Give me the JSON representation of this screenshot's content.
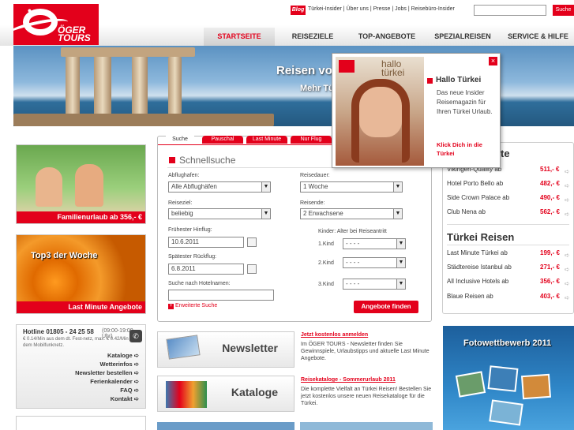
{
  "header": {
    "blog_badge": "Blog",
    "links": "Türkei-Insider | Über uns | Presse | Jobs | Reisebüro-Insider",
    "search_button": "Suche",
    "logo_top": "ÖGER",
    "logo_bottom": "TOURS"
  },
  "nav": [
    "STARTSEITE",
    "REISEZIELE",
    "TOP-ANGEBOTE",
    "SPEZIALREISEN",
    "SERVICE & HILFE"
  ],
  "hero": {
    "line1": "Reisen vo",
    "line2": "Mehr Tü"
  },
  "tiles": {
    "family": "Familienurlaub ab 356,- €",
    "top3": "Top3 der Woche",
    "lastminute": "Last Minute Angebote"
  },
  "hotline": {
    "title": "Hotline 01805 - 24 25 58",
    "hours": "(09:00-19:00 Uhr)",
    "note": "€ 0.14/Min aus dem dt. Fest-netz, max. € 0.42/Min aus dem Mobilfunknetz.",
    "links": [
      "Kataloge",
      "Wetterinfos",
      "Newsletter bestellen",
      "Ferienkalender",
      "FAQ",
      "Kontakt"
    ]
  },
  "search": {
    "tabs": [
      "Suche",
      "Pauschal",
      "Last Minute",
      "Nur Flug"
    ],
    "title": "Schnellsuche",
    "airport_label": "Abflughafen:",
    "airport_value": "Alle Abflughäfen",
    "duration_label": "Reisedauer:",
    "duration_value": "1 Woche",
    "destination_label": "Reiseziel:",
    "destination_value": "beliebig",
    "travellers_label": "Reisende:",
    "travellers_value": "2 Erwachsene",
    "earliest_label": "Frühester Hinflug:",
    "earliest_value": "10.6.2011",
    "latest_label": "Spätester Rückflug:",
    "latest_value": "6.8.2011",
    "children_label": "Kinder: Alter bei Reiseantritt",
    "kids": [
      "1.Kind",
      "2.Kind",
      "3.Kind"
    ],
    "kid_value": "- - - -",
    "hotel_label": "Suche nach Hotelnamen:",
    "extended": "Erweiterte Suche",
    "submit": "Angebote finden"
  },
  "promos": {
    "newsletter": "Newsletter",
    "kataloge": "Kataloge"
  },
  "news": [
    {
      "title": "Jetzt kostenlos anmelden",
      "body": "Im ÖGER TOURS - Newsletter finden Sie Gewinnspiele, Urlaubstipps und aktuelle Last Minute Angebote."
    },
    {
      "title": "Reisekataloge - Sommerurlaub 2011",
      "body": "Die komplette Vielfalt an Türkei Reisen! Bestellen Sie jetzt kostenlos unsere neuen Reisekataloge für die Türkei."
    }
  ],
  "right": {
    "head_partial": "te",
    "hotels": [
      {
        "name": "Vikingen-Quality ab",
        "price": "511,- €"
      },
      {
        "name": "Hotel Porto Bello ab",
        "price": "482,- €"
      },
      {
        "name": "Side Crown Palace ab",
        "price": "490,- €"
      },
      {
        "name": "Club Nena ab",
        "price": "562,- €"
      }
    ],
    "head2": "Türkei Reisen",
    "trips": [
      {
        "name": "Last Minute Türkei ab",
        "price": "199,- €"
      },
      {
        "name": "Städtereise Istanbul ab",
        "price": "271,- €"
      },
      {
        "name": "All Inclusive Hotels ab",
        "price": "356,- €"
      },
      {
        "name": "Blaue Reisen ab",
        "price": "403,- €"
      }
    ]
  },
  "contest": {
    "title": "Fotowettbewerb 2011"
  },
  "popup": {
    "cover_title": "hallo türkei",
    "title": "Hallo Türkei",
    "body": "Das neue Insider Reisemagazin für Ihren Türkei Urlaub.",
    "link": "Klick Dich in die Türkei",
    "close": "×"
  }
}
